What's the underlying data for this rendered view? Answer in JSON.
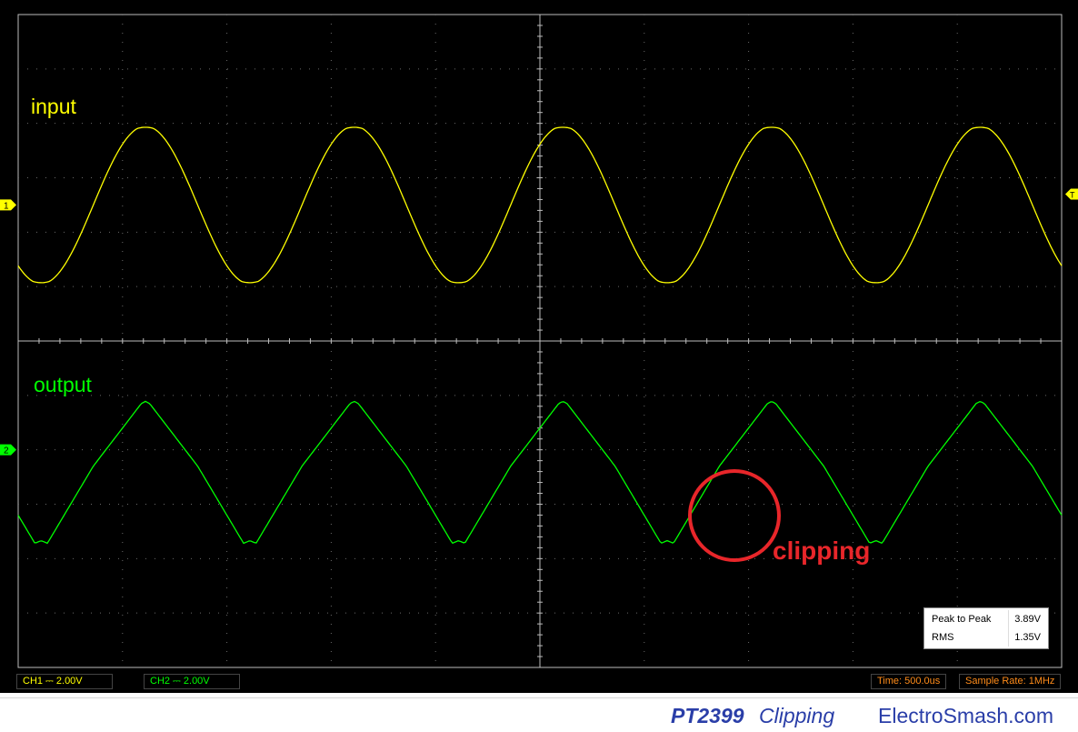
{
  "chart_data": {
    "type": "line",
    "title": "",
    "xlabel": "",
    "ylabel": "",
    "time_per_div": "500.0us",
    "divisions": {
      "x": 10,
      "y": 12
    },
    "grid": true,
    "series": [
      {
        "name": "input",
        "channel": "1",
        "color": "#ffff00",
        "waveform": "sine",
        "peak_div_above_ref": 1.45,
        "trough_div_below_ref": 1.45,
        "period_div": 2.0,
        "start_phase_div": 0.72,
        "reference_div_from_top": 3.5,
        "clipping": false
      },
      {
        "name": "output",
        "channel": "2",
        "color": "#00ff00",
        "waveform": "triangle-like sine",
        "peak_div_above_ref": 1.25,
        "trough_div_below_ref": 1.45,
        "period_div": 2.0,
        "start_phase_div": 0.72,
        "reference_div_from_top": 8.3,
        "clipping": true
      }
    ]
  },
  "labels": {
    "input": "input",
    "output": "output",
    "clipping": "clipping",
    "ch1_marker": "1",
    "ch2_marker": "2",
    "trigger_marker": "T"
  },
  "colors": {
    "input": "#ffff00",
    "output": "#00ff00",
    "clipping": "#e8262a",
    "grid": "#bdbdbd",
    "timebase": "#ff8c1a"
  },
  "measurements": [
    {
      "label": "Peak to Peak",
      "value": "3.89V"
    },
    {
      "label": "RMS",
      "value": "1.35V"
    }
  ],
  "status": {
    "ch1": "CH1 ⎓  2.00V",
    "ch2": "CH2 ⎓  2.00V",
    "time": "Time: 500.0us",
    "sample_rate": "Sample Rate: 1MHz"
  },
  "caption": {
    "model": "PT2399",
    "word": "Clipping",
    "site": "ElectroSmash.com"
  }
}
